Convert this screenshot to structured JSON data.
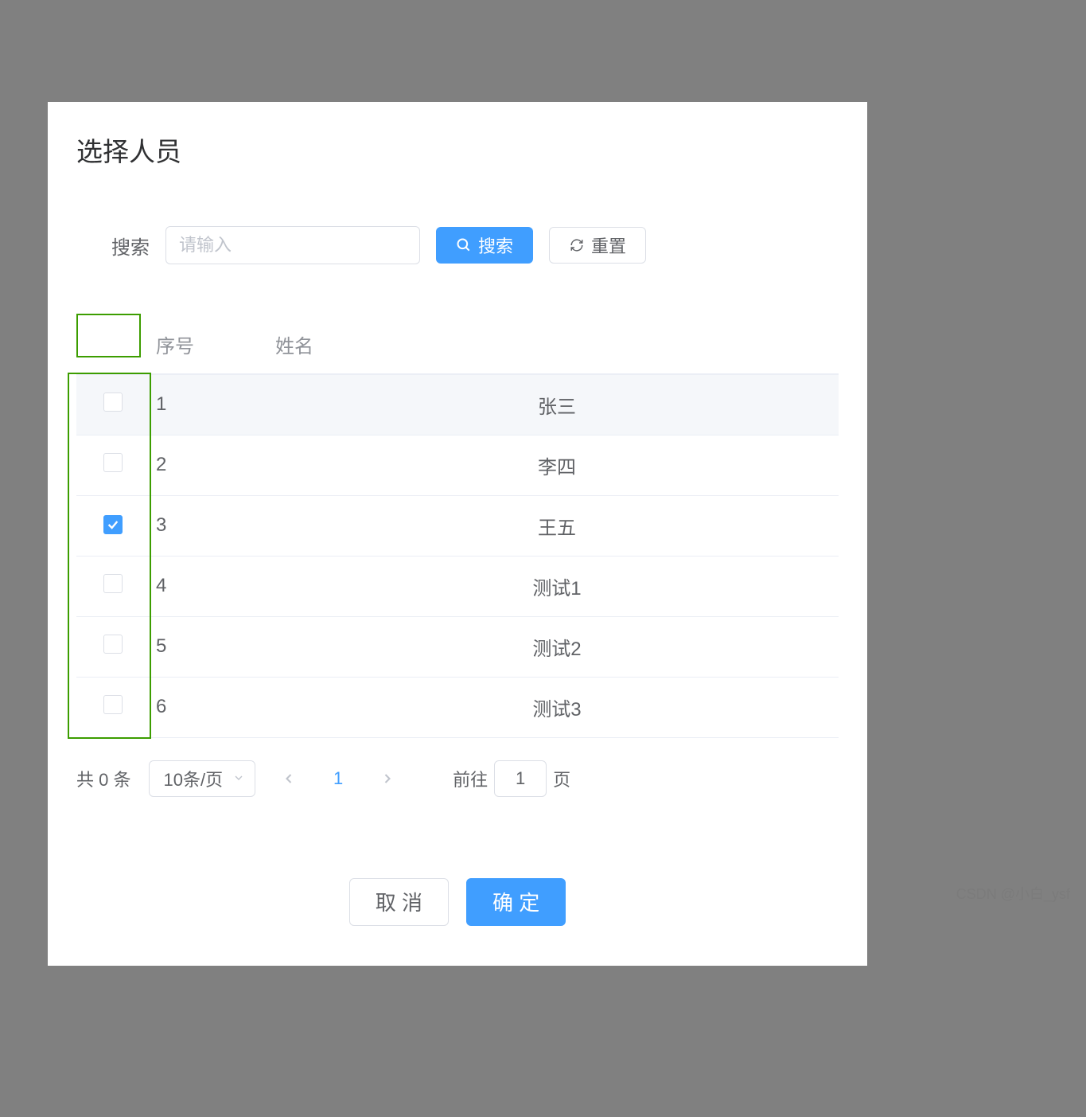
{
  "modal": {
    "title": "选择人员"
  },
  "search": {
    "label": "搜索",
    "placeholder": "请输入",
    "button": "搜索",
    "reset": "重置"
  },
  "table": {
    "columns": {
      "index": "序号",
      "name": "姓名"
    },
    "rows": [
      {
        "idx": "1",
        "name": "张三",
        "checked": false
      },
      {
        "idx": "2",
        "name": "李四",
        "checked": false
      },
      {
        "idx": "3",
        "name": "王五",
        "checked": true
      },
      {
        "idx": "4",
        "name": "测试1",
        "checked": false
      },
      {
        "idx": "5",
        "name": "测试2",
        "checked": false
      },
      {
        "idx": "6",
        "name": "测试3",
        "checked": false
      }
    ]
  },
  "pager": {
    "total_prefix": "共",
    "total_count": "0",
    "total_suffix": "条",
    "page_size": "10条/页",
    "current": "1",
    "goto_prefix": "前往",
    "goto_value": "1",
    "goto_suffix": "页"
  },
  "footer": {
    "cancel": "取 消",
    "confirm": "确 定"
  },
  "watermark": "CSDN @小白_ysf"
}
